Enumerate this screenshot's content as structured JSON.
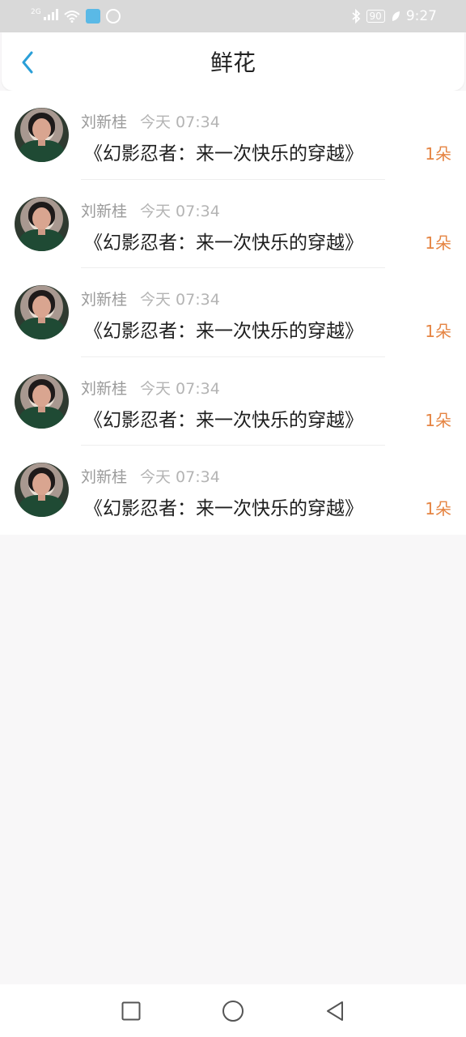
{
  "status": {
    "network": "2G",
    "battery": "90",
    "time": "9:27"
  },
  "header": {
    "title": "鲜花"
  },
  "items": [
    {
      "name": "刘新桂",
      "time": "今天 07:34",
      "book": "《幻影忍者：来一次快乐的穿越》",
      "count": "1朵"
    },
    {
      "name": "刘新桂",
      "time": "今天 07:34",
      "book": "《幻影忍者：来一次快乐的穿越》",
      "count": "1朵"
    },
    {
      "name": "刘新桂",
      "time": "今天 07:34",
      "book": "《幻影忍者：来一次快乐的穿越》",
      "count": "1朵"
    },
    {
      "name": "刘新桂",
      "time": "今天 07:34",
      "book": "《幻影忍者：来一次快乐的穿越》",
      "count": "1朵"
    },
    {
      "name": "刘新桂",
      "time": "今天 07:34",
      "book": "《幻影忍者：来一次快乐的穿越》",
      "count": "1朵"
    }
  ],
  "icons": {
    "back": "chevron-left-icon",
    "recent": "square-icon",
    "home": "circle-icon",
    "navback": "triangle-back-icon"
  },
  "colors": {
    "accent": "#e58442",
    "back": "#2a9fd8"
  }
}
